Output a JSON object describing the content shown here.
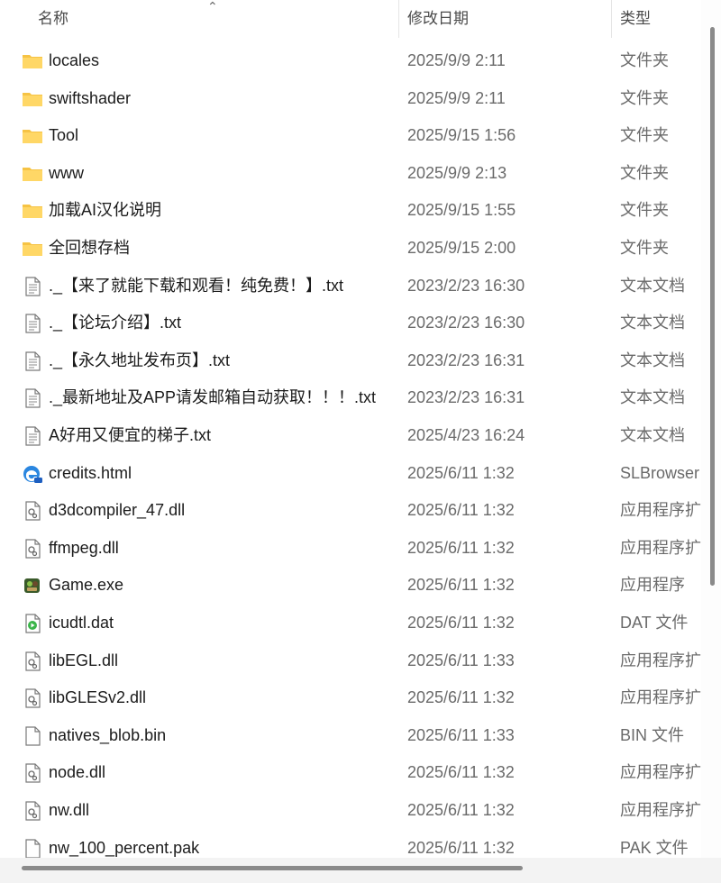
{
  "header": {
    "name": "名称",
    "date": "修改日期",
    "type": "类型",
    "sort": "⌃"
  },
  "files": [
    {
      "name": "locales",
      "date": "2025/9/9 2:11",
      "type": "文件夹",
      "icon": "folder-icon"
    },
    {
      "name": "swiftshader",
      "date": "2025/9/9 2:11",
      "type": "文件夹",
      "icon": "folder-icon"
    },
    {
      "name": "Tool",
      "date": "2025/9/15 1:56",
      "type": "文件夹",
      "icon": "folder-icon"
    },
    {
      "name": "www",
      "date": "2025/9/9 2:13",
      "type": "文件夹",
      "icon": "folder-icon"
    },
    {
      "name": "加载AI汉化说明",
      "date": "2025/9/15 1:55",
      "type": "文件夹",
      "icon": "folder-icon"
    },
    {
      "name": "全回想存档",
      "date": "2025/9/15 2:00",
      "type": "文件夹",
      "icon": "folder-icon"
    },
    {
      "name": "._【来了就能下载和观看！纯免费！】.txt",
      "date": "2023/2/23 16:30",
      "type": "文本文档",
      "icon": "text-file-icon"
    },
    {
      "name": "._【论坛介绍】.txt",
      "date": "2023/2/23 16:30",
      "type": "文本文档",
      "icon": "text-file-icon"
    },
    {
      "name": "._【永久地址发布页】.txt",
      "date": "2023/2/23 16:31",
      "type": "文本文档",
      "icon": "text-file-icon"
    },
    {
      "name": "._最新地址及APP请发邮箱自动获取！！！.txt",
      "date": "2023/2/23 16:31",
      "type": "文本文档",
      "icon": "text-file-icon"
    },
    {
      "name": "A好用又便宜的梯子.txt",
      "date": "2025/4/23 16:24",
      "type": "文本文档",
      "icon": "text-file-icon"
    },
    {
      "name": "credits.html",
      "date": "2025/6/11 1:32",
      "type": "SLBrowser",
      "icon": "browser-icon"
    },
    {
      "name": "d3dcompiler_47.dll",
      "date": "2025/6/11 1:32",
      "type": "应用程序扩展",
      "icon": "dll-file-icon"
    },
    {
      "name": "ffmpeg.dll",
      "date": "2025/6/11 1:32",
      "type": "应用程序扩展",
      "icon": "dll-file-icon"
    },
    {
      "name": "Game.exe",
      "date": "2025/6/11 1:32",
      "type": "应用程序",
      "icon": "game-exe-icon"
    },
    {
      "name": "icudtl.dat",
      "date": "2025/6/11 1:32",
      "type": "DAT 文件",
      "icon": "media-file-icon"
    },
    {
      "name": "libEGL.dll",
      "date": "2025/6/11 1:33",
      "type": "应用程序扩展",
      "icon": "dll-file-icon"
    },
    {
      "name": "libGLESv2.dll",
      "date": "2025/6/11 1:32",
      "type": "应用程序扩展",
      "icon": "dll-file-icon"
    },
    {
      "name": "natives_blob.bin",
      "date": "2025/6/11 1:33",
      "type": "BIN 文件",
      "icon": "blank-file-icon"
    },
    {
      "name": "node.dll",
      "date": "2025/6/11 1:32",
      "type": "应用程序扩展",
      "icon": "dll-file-icon"
    },
    {
      "name": "nw.dll",
      "date": "2025/6/11 1:32",
      "type": "应用程序扩展",
      "icon": "dll-file-icon"
    },
    {
      "name": "nw_100_percent.pak",
      "date": "2025/6/11 1:32",
      "type": "PAK 文件",
      "icon": "blank-file-icon"
    }
  ]
}
